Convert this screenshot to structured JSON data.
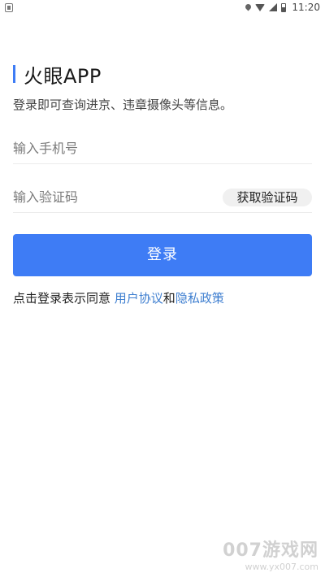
{
  "status_bar": {
    "time": "11:20"
  },
  "header": {
    "title": "火眼APP",
    "subtitle": "登录即可查询进京、违章摄像头等信息。",
    "accent_color": "#3e7cf5"
  },
  "form": {
    "phone_placeholder": "输入手机号",
    "code_placeholder": "输入验证码",
    "get_code_label": "获取验证码",
    "login_label": "登录"
  },
  "agreement": {
    "prefix": "点击登录表示同意 ",
    "user_agreement": "用户协议",
    "conjunction": "和",
    "privacy_policy": "隐私政策",
    "link_color": "#3f7fd0"
  },
  "watermark": {
    "main": "007游戏网",
    "sub": "www.yx007.com"
  }
}
